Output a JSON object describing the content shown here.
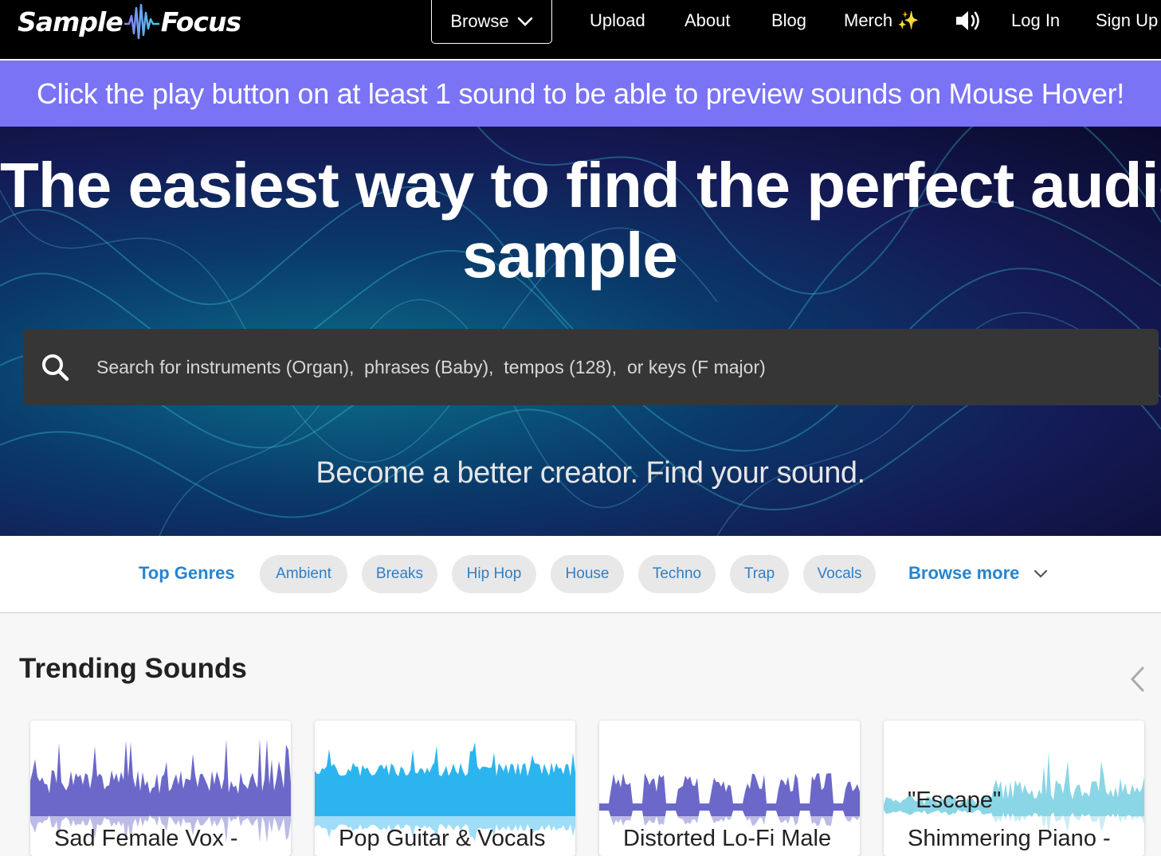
{
  "nav": {
    "logo_left": "Sample",
    "logo_right": "Focus",
    "browse": "Browse",
    "upload": "Upload",
    "about": "About",
    "blog": "Blog",
    "merch": "Merch",
    "login": "Log In",
    "signup": "Sign Up"
  },
  "banner": "Click the play button on at least 1 sound to be able to preview sounds on Mouse Hover!",
  "hero": {
    "title_line1": "The easiest way to find the perfect audio",
    "title_line2": "sample",
    "search_placeholder": "Search for instruments (Organ),  phrases (Baby),  tempos (128),  or keys (F major)",
    "tagline": "Become a better creator. Find your sound."
  },
  "genres": {
    "heading": "Top Genres",
    "items": [
      "Ambient",
      "Breaks",
      "Hip Hop",
      "House",
      "Techno",
      "Trap",
      "Vocals"
    ],
    "browse_more": "Browse more"
  },
  "trending": {
    "title": "Trending Sounds",
    "cards": [
      {
        "title": "Sad Female Vox -",
        "wave_color": "#6b68c9"
      },
      {
        "title": "Pop Guitar & Vocals",
        "wave_color": "#2cb4ef"
      },
      {
        "title": "Distorted Lo-Fi Male",
        "wave_color": "#6b68c9"
      },
      {
        "title_line1": "\"Escape\"",
        "title_line2": "Shimmering Piano -",
        "wave_color": "#8ad6e6"
      }
    ]
  },
  "colors": {
    "banner": "#7a73f5",
    "link_blue": "#2784cf",
    "nav_bg": "#000000"
  }
}
